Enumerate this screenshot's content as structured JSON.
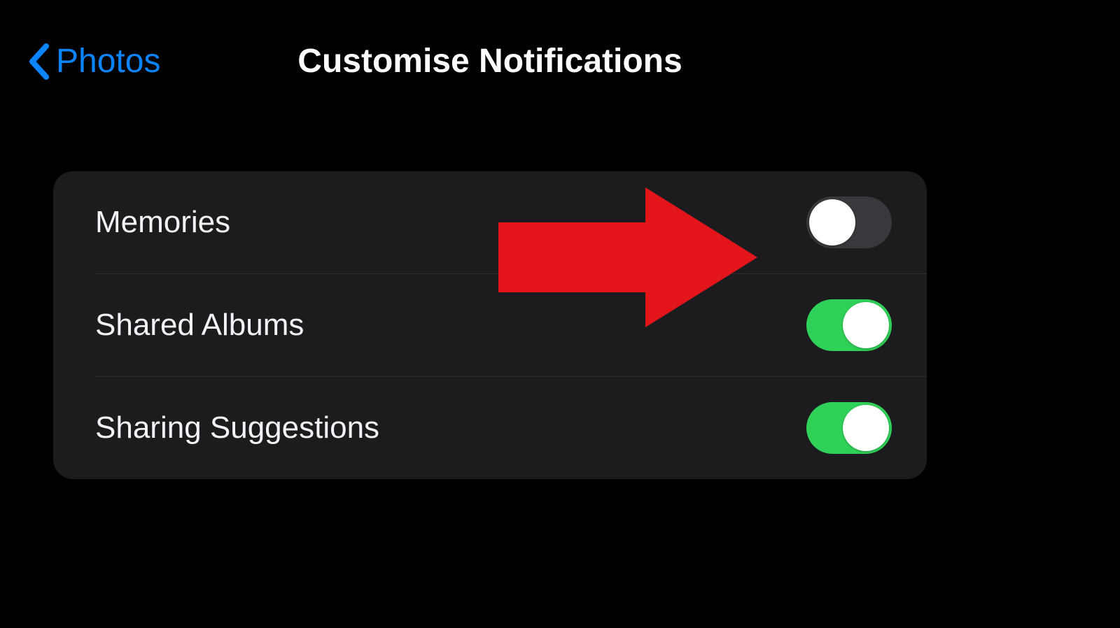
{
  "nav": {
    "back_label": "Photos",
    "title": "Customise Notifications"
  },
  "settings": {
    "rows": [
      {
        "label": "Memories",
        "on": false
      },
      {
        "label": "Shared Albums",
        "on": true
      },
      {
        "label": "Sharing Suggestions",
        "on": true
      }
    ]
  },
  "colors": {
    "accent": "#0a84ff",
    "toggle_on": "#30d158",
    "toggle_off": "#39393d",
    "annotation": "#e3141a"
  },
  "annotation": {
    "type": "arrow",
    "points_to": "toggle-memories"
  }
}
